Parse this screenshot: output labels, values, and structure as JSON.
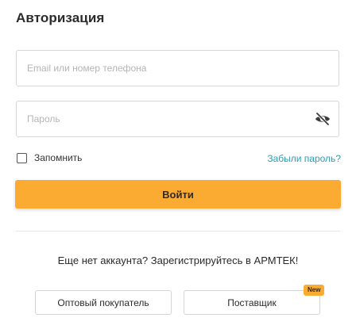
{
  "auth": {
    "title": "Авторизация",
    "email_placeholder": "Email или номер телефона",
    "password_placeholder": "Пароль",
    "remember_label": "Запомнить",
    "forgot_link": "Забыли пароль?",
    "login_button": "Войти"
  },
  "register": {
    "prompt": "Еще нет аккаунта? Зарегистрируйтесь в АРМТЕК!",
    "wholesale_button": "Оптовый покупатель",
    "supplier_button": "Поставщик",
    "supplier_badge": "New"
  },
  "icons": {
    "password_toggle": "eye-slash-icon"
  },
  "colors": {
    "accent": "#fbab32",
    "link": "#2a9fb3"
  }
}
